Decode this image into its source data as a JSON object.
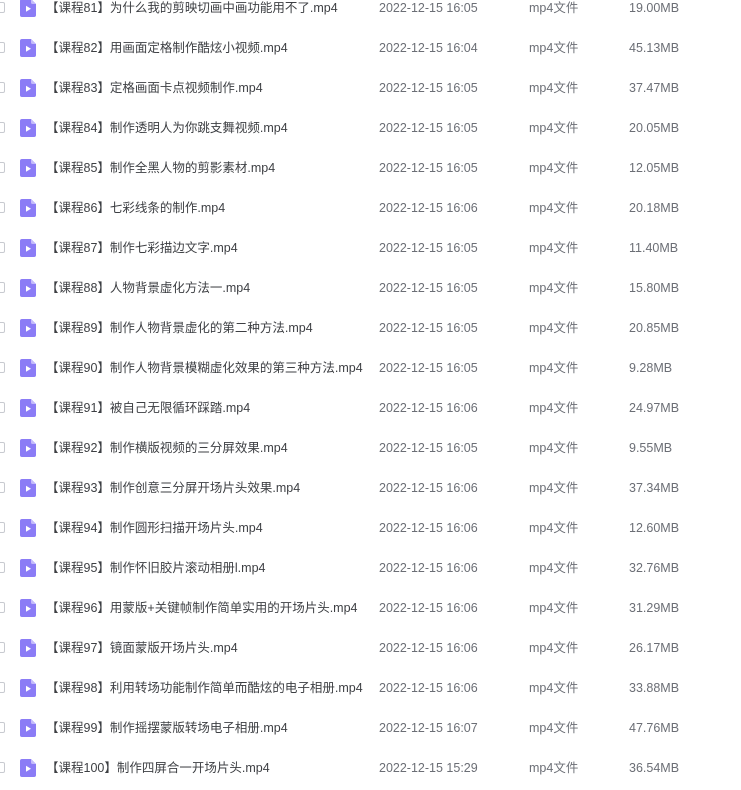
{
  "file_list": {
    "icon": "video-file-icon",
    "icon_color": "#8b7cf6",
    "rows": [
      {
        "name": "【课程81】为什么我的剪映切画中画功能用不了.mp4",
        "date": "2022-12-15 16:05",
        "type": "mp4文件",
        "size": "19.00MB"
      },
      {
        "name": "【课程82】用画面定格制作酷炫小视频.mp4",
        "date": "2022-12-15 16:04",
        "type": "mp4文件",
        "size": "45.13MB"
      },
      {
        "name": "【课程83】定格画面卡点视频制作.mp4",
        "date": "2022-12-15 16:05",
        "type": "mp4文件",
        "size": "37.47MB"
      },
      {
        "name": "【课程84】制作透明人为你跳支舞视频.mp4",
        "date": "2022-12-15 16:05",
        "type": "mp4文件",
        "size": "20.05MB"
      },
      {
        "name": "【课程85】制作全黑人物的剪影素材.mp4",
        "date": "2022-12-15 16:05",
        "type": "mp4文件",
        "size": "12.05MB"
      },
      {
        "name": "【课程86】七彩线条的制作.mp4",
        "date": "2022-12-15 16:06",
        "type": "mp4文件",
        "size": "20.18MB"
      },
      {
        "name": "【课程87】制作七彩描边文字.mp4",
        "date": "2022-12-15 16:05",
        "type": "mp4文件",
        "size": "11.40MB"
      },
      {
        "name": "【课程88】人物背景虚化方法一.mp4",
        "date": "2022-12-15 16:05",
        "type": "mp4文件",
        "size": "15.80MB"
      },
      {
        "name": "【课程89】制作人物背景虚化的第二种方法.mp4",
        "date": "2022-12-15 16:05",
        "type": "mp4文件",
        "size": "20.85MB"
      },
      {
        "name": "【课程90】制作人物背景模糊虚化效果的第三种方法.mp4",
        "date": "2022-12-15 16:05",
        "type": "mp4文件",
        "size": "9.28MB"
      },
      {
        "name": "【课程91】被自己无限循环踩踏.mp4",
        "date": "2022-12-15 16:06",
        "type": "mp4文件",
        "size": "24.97MB"
      },
      {
        "name": "【课程92】制作横版视频的三分屏效果.mp4",
        "date": "2022-12-15 16:05",
        "type": "mp4文件",
        "size": "9.55MB"
      },
      {
        "name": "【课程93】制作创意三分屏开场片头效果.mp4",
        "date": "2022-12-15 16:06",
        "type": "mp4文件",
        "size": "37.34MB"
      },
      {
        "name": "【课程94】制作圆形扫描开场片头.mp4",
        "date": "2022-12-15 16:06",
        "type": "mp4文件",
        "size": "12.60MB"
      },
      {
        "name": "【课程95】制作怀旧胶片滚动相册l.mp4",
        "date": "2022-12-15 16:06",
        "type": "mp4文件",
        "size": "32.76MB"
      },
      {
        "name": "【课程96】用蒙版+关键帧制作简单实用的开场片头.mp4",
        "date": "2022-12-15 16:06",
        "type": "mp4文件",
        "size": "31.29MB"
      },
      {
        "name": "【课程97】镜面蒙版开场片头.mp4",
        "date": "2022-12-15 16:06",
        "type": "mp4文件",
        "size": "26.17MB"
      },
      {
        "name": "【课程98】利用转场功能制作简单而酷炫的电子相册.mp4",
        "date": "2022-12-15 16:06",
        "type": "mp4文件",
        "size": "33.88MB"
      },
      {
        "name": "【课程99】制作摇摆蒙版转场电子相册.mp4",
        "date": "2022-12-15 16:07",
        "type": "mp4文件",
        "size": "47.76MB"
      },
      {
        "name": "【课程100】制作四屏合一开场片头.mp4",
        "date": "2022-12-15 15:29",
        "type": "mp4文件",
        "size": "36.54MB"
      }
    ]
  }
}
